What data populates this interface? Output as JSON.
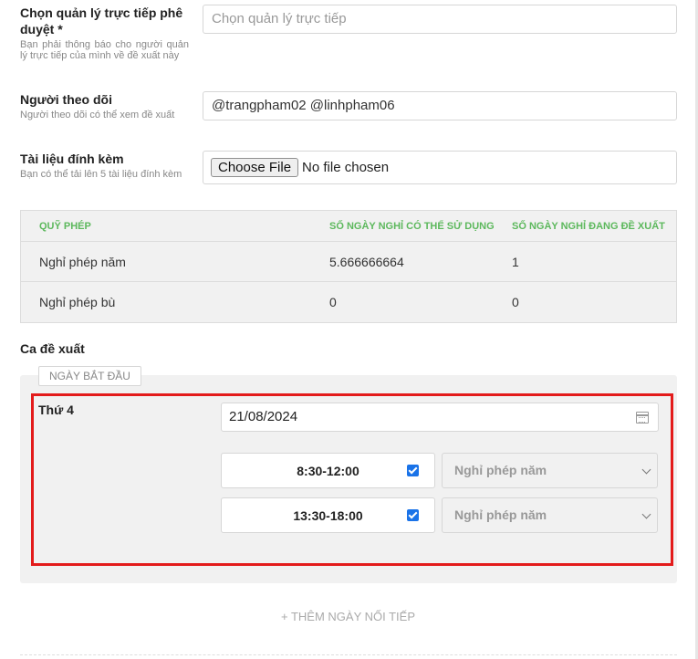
{
  "manager": {
    "label": "Chọn quản lý trực tiếp phê duyệt *",
    "hint": "Bạn phải thông báo cho người quản lý trực tiếp của mình về đề xuất này",
    "placeholder": "Chọn quản lý trực tiếp"
  },
  "followers": {
    "label": "Người theo dõi",
    "hint": "Người theo dõi có thể xem đề xuất",
    "value": "@trangpham02 @linhpham06"
  },
  "attachments": {
    "label": "Tài liệu đính kèm",
    "hint": "Bạn có thể tải lên 5 tài liệu đính kèm",
    "button": "Choose File",
    "status": "No file chosen"
  },
  "leave_table": {
    "headers": [
      "QUỸ PHÉP",
      "SỐ NGÀY NGHỈ CÓ THỂ SỬ DỤNG",
      "SỐ NGÀY NGHỈ ĐANG ĐỀ XUẤT"
    ],
    "rows": [
      [
        "Nghỉ phép năm",
        "5.666666664",
        "1"
      ],
      [
        "Nghỉ phép bù",
        "0",
        "0"
      ]
    ]
  },
  "shift": {
    "title": "Ca đề xuất",
    "start_date_tag": "NGÀY BẮT ĐẦU",
    "day": "Thứ 4",
    "date": "21/08/2024",
    "slots": [
      {
        "time": "8:30-12:00",
        "checked": true,
        "leave_type": "Nghỉ phép năm"
      },
      {
        "time": "13:30-18:00",
        "checked": true,
        "leave_type": "Nghỉ phép năm"
      }
    ],
    "add_more": "+ THÊM NGÀY NỐI TIẾP"
  },
  "colors": {
    "accent_green": "#5cb85c",
    "highlight_red": "#e31b1b",
    "checkbox_blue": "#1a73e8"
  }
}
